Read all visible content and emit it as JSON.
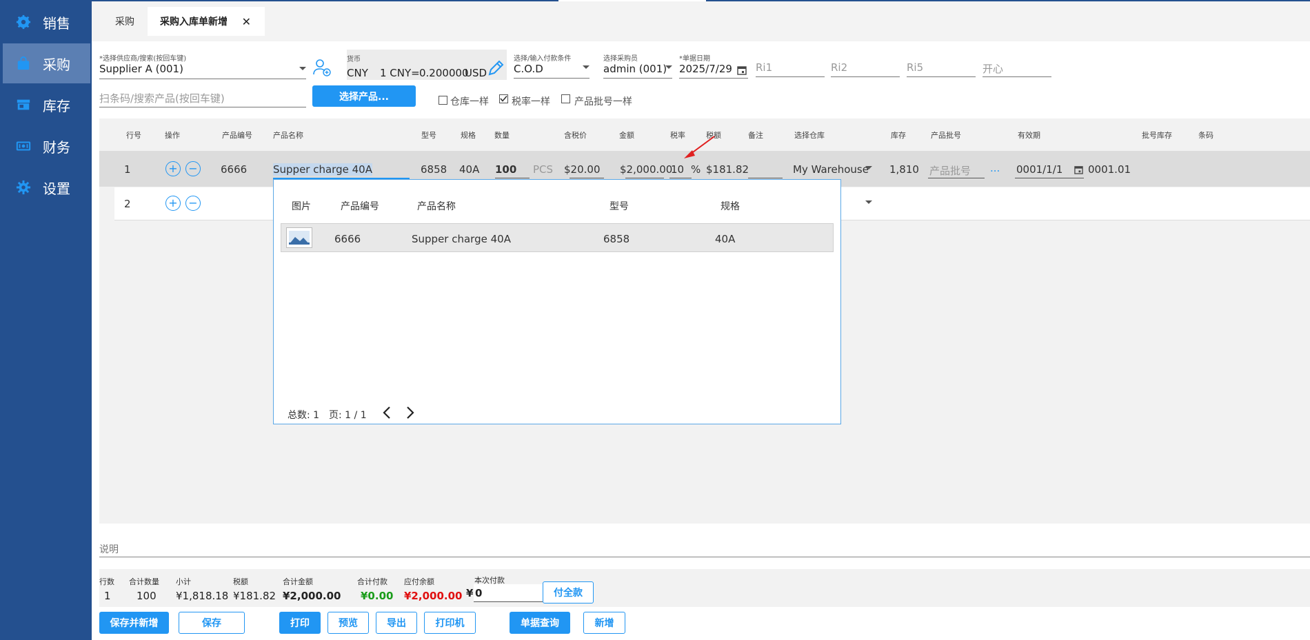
{
  "sidebar": {
    "items": [
      {
        "label": "销售",
        "icon": "gear-badge-icon"
      },
      {
        "label": "采购",
        "icon": "shopping-bag-icon"
      },
      {
        "label": "库存",
        "icon": "store-icon"
      },
      {
        "label": "财务",
        "icon": "cash-icon"
      },
      {
        "label": "设置",
        "icon": "gear-icon"
      }
    ],
    "active": "采购"
  },
  "tabs": [
    {
      "label": "采购"
    },
    {
      "label": "采购入库单新增",
      "close": "✕"
    }
  ],
  "form": {
    "supplier": {
      "label": "*选择供应商/搜索(按回车键)",
      "value": "Supplier A (001)"
    },
    "currency": {
      "label": "货币",
      "code": "CNY",
      "rate_prefix": "1 CNY=",
      "rate_value": "0.200000",
      "rate_suffix": "USD"
    },
    "payment_terms": {
      "label": "选择/输入付款条件",
      "value": "C.O.D"
    },
    "buyer": {
      "label": "选择采购员",
      "value": "admin (001)"
    },
    "date": {
      "label": "*单据日期",
      "value": "2025/7/29"
    },
    "ri1": {
      "placeholder": "Ri1"
    },
    "ri2": {
      "placeholder": "Ri2"
    },
    "ri5": {
      "placeholder": "Ri5"
    },
    "kaixin": {
      "placeholder": "开心"
    },
    "barcode": {
      "placeholder": "扫条码/搜索产品(按回车键)"
    },
    "select_product_button": "选择产品...",
    "checkboxes": [
      {
        "label": "仓库一样",
        "checked": false
      },
      {
        "label": "税率一样",
        "checked": true
      },
      {
        "label": "产品批号一样",
        "checked": false
      }
    ]
  },
  "grid": {
    "headers": [
      "行号",
      "操作",
      "产品编号",
      "产品名称",
      "型号",
      "规格",
      "数量",
      "含税价",
      "金额",
      "税率",
      "税额",
      "备注",
      "选择仓库",
      "库存",
      "产品批号",
      "有效期",
      "批号库存",
      "条码"
    ],
    "rows": [
      {
        "line": "1",
        "code": "6666",
        "name": "Supper charge  40A",
        "model": "6858",
        "spec": "40A",
        "qty": "100",
        "unit": "PCS",
        "price": "$20.00",
        "amount": "$2,000.00",
        "tax_rate": "10",
        "percent": "%",
        "tax": "$181.82",
        "warehouse": "My Warehouse",
        "stock": "1,810",
        "batch_placeholder": "产品批号",
        "more": "...",
        "expiry": "0001/1/1",
        "batch_stock": "0001.01"
      },
      {
        "line": "2"
      }
    ],
    "plus": "+",
    "minus": "−"
  },
  "popup": {
    "headers": [
      "图片",
      "产品编号",
      "产品名称",
      "型号",
      "规格"
    ],
    "rows": [
      {
        "code": "6666",
        "name": "Supper charge  40A",
        "model": "6858",
        "spec": "40A"
      }
    ],
    "total_label": "总数: 1",
    "page_label": "页: 1 / 1"
  },
  "notes": {
    "label": "说明"
  },
  "summary": {
    "line_count": {
      "label": "行数",
      "value": "1"
    },
    "total_qty": {
      "label": "合计数量",
      "value": "100"
    },
    "subtotal": {
      "label": "小计",
      "value": "¥1,818.18"
    },
    "tax": {
      "label": "税额",
      "value": "¥181.82"
    },
    "total": {
      "label": "合计金额",
      "value": "¥2,000.00"
    },
    "paid": {
      "label": "合计付款",
      "value": "¥0.00",
      "color": "#1a9c1a"
    },
    "balance": {
      "label": "应付余额",
      "value": "¥2,000.00",
      "color": "#e01010"
    },
    "this_payment": {
      "label": "本次付款",
      "symbol": "¥",
      "value": "0"
    },
    "pay_all_button": "付全款"
  },
  "actions": {
    "save_new": "保存并新增",
    "save": "保存",
    "print": "打印",
    "preview": "预览",
    "export": "导出",
    "printer": "打印机",
    "query": "单据查询",
    "new": "新增"
  },
  "colors": {
    "sidebar": "#24508f",
    "accent": "#2196f3",
    "arrow": "#e02020"
  }
}
